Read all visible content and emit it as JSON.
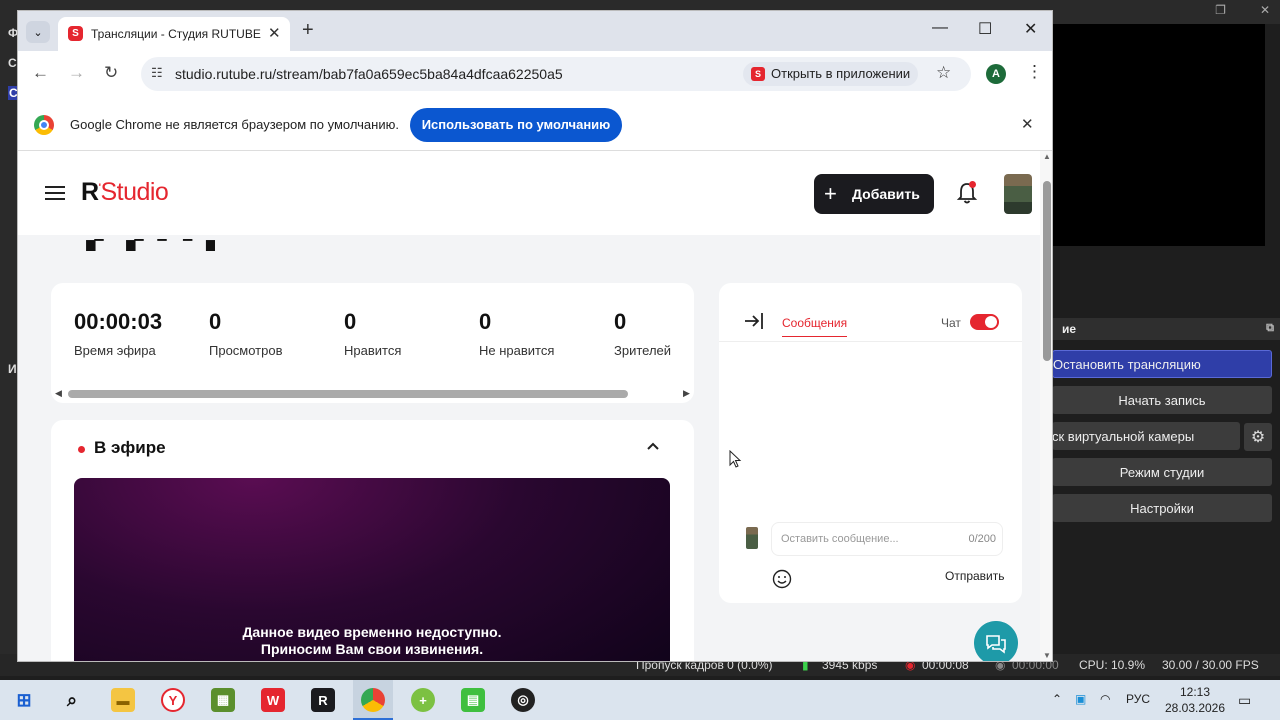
{
  "obs": {
    "panel_title": "ие",
    "buttons": {
      "stop_stream": "Остановить трансляцию",
      "start_record": "Начать запись",
      "virtual_cam": "ск виртуальной камеры",
      "studio_mode": "Режим студии",
      "settings": "Настройки"
    },
    "left_letters": [
      "Ф",
      "С",
      "С",
      "И"
    ],
    "status": {
      "dropped": "Пропуск кадров 0 (0.0%)",
      "kbps": "3945 kbps",
      "stream_time": "00:00:08",
      "record_time": "00:00:00",
      "cpu": "CPU: 10.9%",
      "fps": "30.00 / 30.00 FPS"
    },
    "accent": "#2f3ea8"
  },
  "taskbar": {
    "lang": "РУС",
    "time": "12:13",
    "date": "28.03.2026"
  },
  "browser": {
    "tab_title": "Трансляции - Студия RUTUBE",
    "url": "studio.rutube.ru/stream/bab7fa0a659ec5ba84a4dfcaa62250a5",
    "open_in_app": "Открыть в приложении",
    "profile_initial": "A",
    "infobar_text": "Google Chrome не является браузером по умолчанию.",
    "infobar_button": "Использовать по умолчанию",
    "accent": "#0b57d0"
  },
  "page": {
    "logo_prefix": "R",
    "logo_studio": "Studio",
    "add_button": "Добавить",
    "brand_color": "#e5262f",
    "stats": [
      {
        "value": "00:00:03",
        "label": "Время эфира"
      },
      {
        "value": "0",
        "label": "Просмотров"
      },
      {
        "value": "0",
        "label": "Нравится"
      },
      {
        "value": "0",
        "label": "Не нравится"
      },
      {
        "value": "0",
        "label": "Зрителей"
      }
    ],
    "live_title": "В эфире",
    "video_message_line1": "Данное видео временно недоступно.",
    "video_message_line2": "Приносим Вам свои извинения.",
    "chat": {
      "tab_messages": "Сообщения",
      "chat_label": "Чат",
      "input_placeholder": "Оставить сообщение...",
      "counter": "0/200",
      "send": "Отправить"
    }
  }
}
